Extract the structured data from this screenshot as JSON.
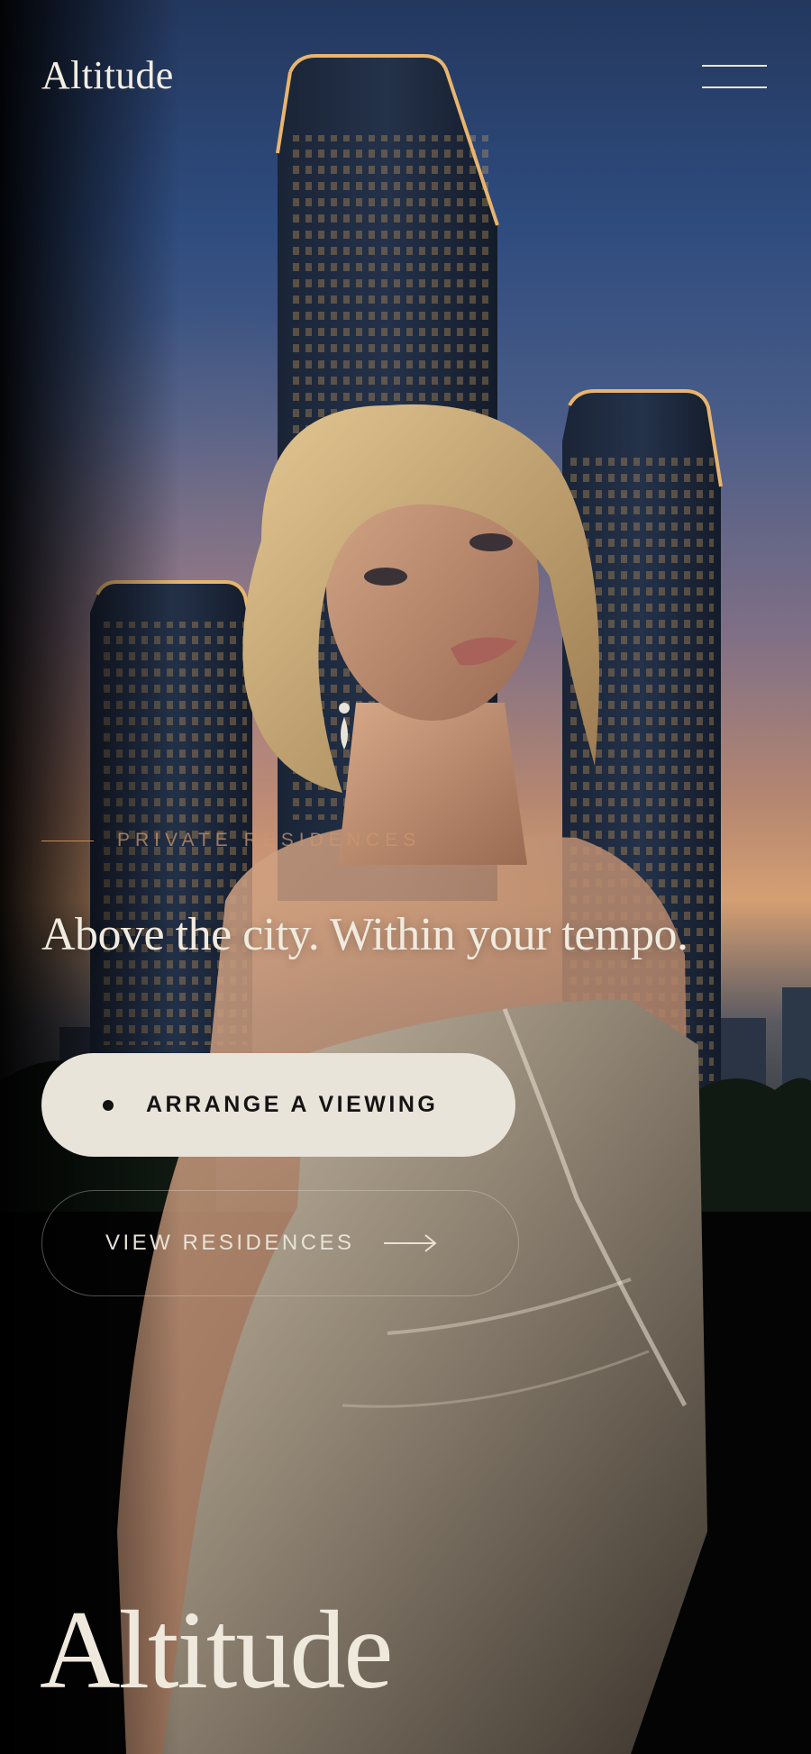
{
  "header": {
    "brand": "Altitude",
    "menu_icon": "hamburger-menu-icon"
  },
  "hero": {
    "eyebrow": "PRIVATE RESIDENCES",
    "headline": "Above the city. Within your tempo.",
    "primary_cta": {
      "label": "ARRANGE A VIEWING",
      "icon": "dot-icon"
    },
    "secondary_cta": {
      "label": "VIEW RESIDENCES",
      "icon": "arrow-right-icon"
    }
  },
  "footer": {
    "brand": "Altitude"
  },
  "colors": {
    "background": "#050505",
    "cream": "#e9e4da",
    "accent": "#c38a55",
    "text_light": "#f1eadf"
  }
}
